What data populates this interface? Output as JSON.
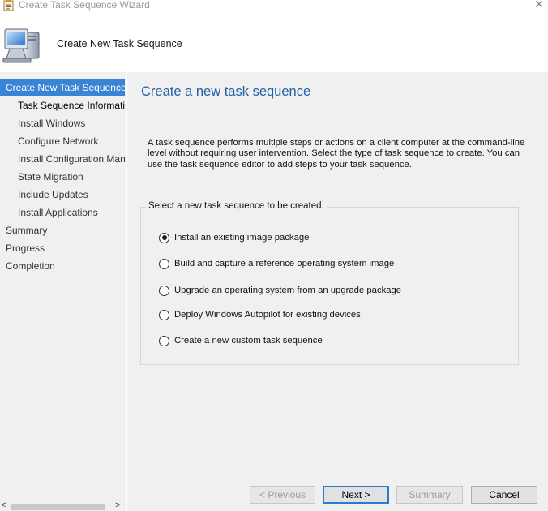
{
  "window": {
    "title": "Create Task Sequence Wizard",
    "close_glyph": "✕"
  },
  "header": {
    "title": "Create New Task Sequence"
  },
  "nav": {
    "items": [
      {
        "label": "Create New Task Sequence",
        "level": 0,
        "selected": true
      },
      {
        "label": "Task Sequence Information",
        "level": 1,
        "current": true
      },
      {
        "label": "Install Windows",
        "level": 1
      },
      {
        "label": "Configure Network",
        "level": 1
      },
      {
        "label": "Install Configuration Manager",
        "level": 1
      },
      {
        "label": "State Migration",
        "level": 1
      },
      {
        "label": "Include Updates",
        "level": 1
      },
      {
        "label": "Install Applications",
        "level": 1
      },
      {
        "label": "Summary",
        "level": 0
      },
      {
        "label": "Progress",
        "level": 0
      },
      {
        "label": "Completion",
        "level": 0
      }
    ],
    "scroll_left": "<",
    "scroll_right": ">"
  },
  "main": {
    "heading": "Create a new task sequence",
    "description": "A task sequence performs multiple steps or actions on a client computer at the command-line level without requiring user intervention. Select the type of task sequence to create. You can use the task sequence editor to add steps to your task sequence.",
    "group_label": "Select a new task sequence to be created.",
    "options": [
      {
        "label": "Install an existing image package",
        "checked": true
      },
      {
        "label": "Build and capture a reference operating system image",
        "checked": false
      },
      {
        "label": "Upgrade an operating system from an upgrade package",
        "checked": false
      },
      {
        "label": "Deploy Windows Autopilot for existing devices",
        "checked": false
      },
      {
        "label": "Create a new custom task sequence",
        "checked": false
      }
    ]
  },
  "buttons": {
    "previous": "< Previous",
    "next": "Next >",
    "summary": "Summary",
    "cancel": "Cancel"
  }
}
